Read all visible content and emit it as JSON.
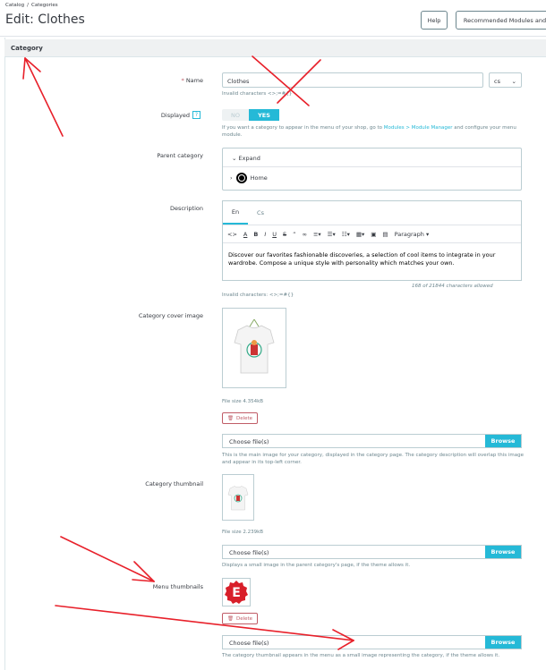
{
  "breadcrumb": [
    "Catalog",
    "Categories"
  ],
  "page_title": "Edit: Clothes",
  "header_buttons": {
    "help": "Help",
    "recommended": "Recommended Modules and"
  },
  "panel_title": "Category",
  "name_field": {
    "label": "Name",
    "value": "Clothes",
    "lang": "cs",
    "hint": "Invalid characters <>;=#{}"
  },
  "displayed": {
    "label": "Displayed",
    "no": "NO",
    "yes": "YES",
    "hint_before": "If you want a category to appear in the menu of your shop, go to ",
    "hint_link": "Modules > Module Manager",
    "hint_after": " and configure your menu module."
  },
  "parent_category": {
    "label": "Parent category",
    "expand": "Expand",
    "home": "Home"
  },
  "description": {
    "label": "Description",
    "tabs": [
      "En",
      "Cs"
    ],
    "paragraph": "Paragraph",
    "text": "Discover our favorites fashionable discoveries, a selection of cool items to integrate in your wardrobe. Compose a unique style with personality which matches your own.",
    "counter": "168 of 21844 characters allowed",
    "hint": "Invalid characters: <>;=#{}"
  },
  "cover_image": {
    "label": "Category cover image",
    "file_size": "File size 4.354kB",
    "delete": "Delete",
    "choose": "Choose file(s)",
    "browse": "Browse",
    "hint": "This is the main image for your category, displayed in the category page. The category description will overlap this image and appear in its top-left corner."
  },
  "thumbnail": {
    "label": "Category thumbnail",
    "file_size": "File size 2.239kB",
    "choose": "Choose file(s)",
    "browse": "Browse",
    "hint": "Displays a small image in the parent category's page, if the theme allows it."
  },
  "menu_thumbnails": {
    "label": "Menu thumbnails",
    "logo_letter": "E",
    "delete": "Delete",
    "choose": "Choose file(s)",
    "browse": "Browse",
    "hint": "The category thumbnail appears in the menu as a small image representing the category, if the theme allows it."
  },
  "colors": {
    "accent": "#25b9d7",
    "danger": "#c05c67",
    "annotation": "#e8202a"
  }
}
